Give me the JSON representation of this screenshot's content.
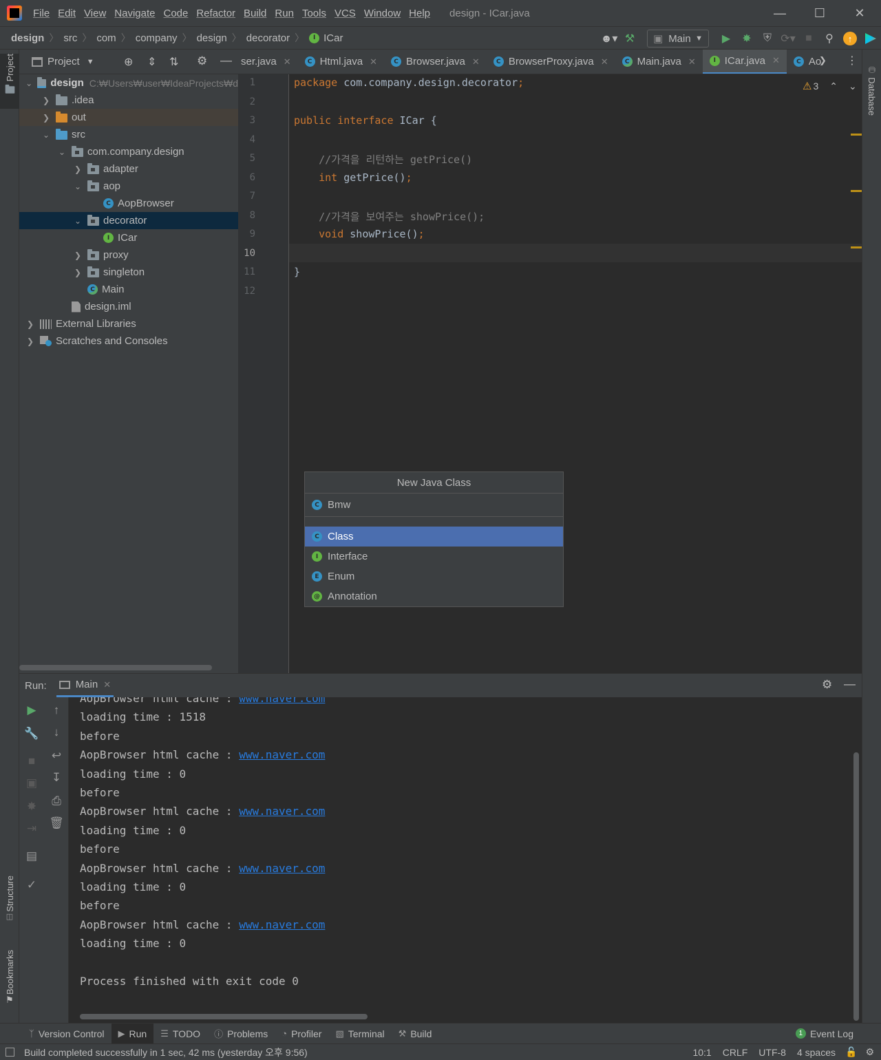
{
  "window": {
    "title": "design - ICar.java",
    "menu": [
      "File",
      "Edit",
      "View",
      "Navigate",
      "Code",
      "Refactor",
      "Build",
      "Run",
      "Tools",
      "VCS",
      "Window",
      "Help"
    ]
  },
  "breadcrumbs": [
    "design",
    "src",
    "com",
    "company",
    "design",
    "decorator",
    "ICar"
  ],
  "toolbar": {
    "run_config": "Main"
  },
  "project_panel": {
    "title": "Project",
    "root_path": "C:₩Users₩user₩IdeaProjects₩d",
    "tree": [
      {
        "label": "design",
        "level": 0,
        "expand": "open",
        "icon": "module-folder"
      },
      {
        "label": ".idea",
        "level": 1,
        "expand": "closed",
        "icon": "folder"
      },
      {
        "label": "out",
        "level": 1,
        "expand": "closed",
        "icon": "folder-orange"
      },
      {
        "label": "src",
        "level": 1,
        "expand": "open",
        "icon": "folder-blue"
      },
      {
        "label": "com.company.design",
        "level": 2,
        "expand": "open",
        "icon": "package"
      },
      {
        "label": "adapter",
        "level": 3,
        "expand": "closed",
        "icon": "package"
      },
      {
        "label": "aop",
        "level": 3,
        "expand": "open",
        "icon": "package"
      },
      {
        "label": "AopBrowser",
        "level": 4,
        "expand": "none",
        "icon": "class"
      },
      {
        "label": "decorator",
        "level": 3,
        "expand": "open",
        "icon": "package"
      },
      {
        "label": "ICar",
        "level": 4,
        "expand": "none",
        "icon": "interface"
      },
      {
        "label": "proxy",
        "level": 3,
        "expand": "closed",
        "icon": "package"
      },
      {
        "label": "singleton",
        "level": 3,
        "expand": "closed",
        "icon": "package"
      },
      {
        "label": "Main",
        "level": 3,
        "expand": "none",
        "icon": "class-run"
      },
      {
        "label": "design.iml",
        "level": 2,
        "expand": "none",
        "icon": "file"
      },
      {
        "label": "External Libraries",
        "level": 0,
        "expand": "closed",
        "icon": "libraries"
      },
      {
        "label": "Scratches and Consoles",
        "level": 0,
        "expand": "closed",
        "icon": "scratches"
      }
    ]
  },
  "editor_tabs": [
    {
      "label": "ser.java",
      "icon": "none",
      "active": false
    },
    {
      "label": "Html.java",
      "icon": "class",
      "active": false
    },
    {
      "label": "Browser.java",
      "icon": "class",
      "active": false
    },
    {
      "label": "BrowserProxy.java",
      "icon": "class",
      "active": false
    },
    {
      "label": "Main.java",
      "icon": "class-run",
      "active": false
    },
    {
      "label": "ICar.java",
      "icon": "interface",
      "active": true
    },
    {
      "label": "Ao",
      "icon": "class",
      "active": false
    }
  ],
  "editor": {
    "warnings": "3",
    "current_line": "10",
    "line_numbers": [
      "1",
      "2",
      "3",
      "4",
      "5",
      "6",
      "7",
      "8",
      "9",
      "10",
      "11",
      "12"
    ],
    "lines": [
      [
        {
          "t": "package ",
          "c": "kw"
        },
        {
          "t": "com.company.design.decorator",
          "c": "fn"
        },
        {
          "t": ";",
          "c": "kw"
        }
      ],
      [],
      [
        {
          "t": "public interface ",
          "c": "kw"
        },
        {
          "t": "ICar ",
          "c": "fn"
        },
        {
          "t": "{",
          "c": "fn"
        }
      ],
      [],
      [
        {
          "t": "    //가격을 리턴하는 getPrice()",
          "c": "cm"
        }
      ],
      [
        {
          "t": "    int ",
          "c": "kw"
        },
        {
          "t": "getPrice()",
          "c": "fn"
        },
        {
          "t": ";",
          "c": "kw"
        }
      ],
      [],
      [
        {
          "t": "    //가격을 보여주는 showPrice();",
          "c": "cm"
        }
      ],
      [
        {
          "t": "    void ",
          "c": "kw"
        },
        {
          "t": "showPrice()",
          "c": "fn"
        },
        {
          "t": ";",
          "c": "kw"
        }
      ],
      [],
      [
        {
          "t": "}",
          "c": "fn"
        }
      ],
      []
    ]
  },
  "popup": {
    "title": "New Java Class",
    "name_value": "Bmw",
    "options": [
      {
        "label": "Class",
        "icon": "class",
        "selected": true
      },
      {
        "label": "Interface",
        "icon": "interface",
        "selected": false
      },
      {
        "label": "Enum",
        "icon": "enum",
        "selected": false
      },
      {
        "label": "Annotation",
        "icon": "annotation",
        "selected": false
      }
    ]
  },
  "run_panel": {
    "label": "Run:",
    "tab": "Main",
    "output": [
      {
        "text": "AopBrowser html cache : ",
        "link": "www.naver.com"
      },
      {
        "text": "loading time : 1518"
      },
      {
        "text": "before"
      },
      {
        "text": "AopBrowser html cache : ",
        "link": "www.naver.com"
      },
      {
        "text": "loading time : 0"
      },
      {
        "text": "before"
      },
      {
        "text": "AopBrowser html cache : ",
        "link": "www.naver.com"
      },
      {
        "text": "loading time : 0"
      },
      {
        "text": "before"
      },
      {
        "text": "AopBrowser html cache : ",
        "link": "www.naver.com"
      },
      {
        "text": "loading time : 0"
      },
      {
        "text": "before"
      },
      {
        "text": "AopBrowser html cache : ",
        "link": "www.naver.com"
      },
      {
        "text": "loading time : 0"
      },
      {
        "text": ""
      },
      {
        "text": "Process finished with exit code 0"
      }
    ]
  },
  "side_tabs": {
    "left_top": "Project",
    "left_mid": "Structure",
    "left_bottom": "Bookmarks",
    "right": "Database"
  },
  "bottom_tabs": [
    {
      "label": "Version Control",
      "icon": "branch-icon",
      "active": false
    },
    {
      "label": "Run",
      "icon": "play-icon",
      "active": true
    },
    {
      "label": "TODO",
      "icon": "list-icon",
      "active": false
    },
    {
      "label": "Problems",
      "icon": "info-icon",
      "active": false
    },
    {
      "label": "Profiler",
      "icon": "profiler-icon",
      "active": false
    },
    {
      "label": "Terminal",
      "icon": "terminal-icon",
      "active": false
    },
    {
      "label": "Build",
      "icon": "hammer-icon",
      "active": false
    }
  ],
  "event_log": {
    "count": "1",
    "label": "Event Log"
  },
  "status": {
    "message": "Build completed successfully in 1 sec, 42 ms (yesterday 오후 9:56)",
    "position": "10:1",
    "line_sep": "CRLF",
    "encoding": "UTF-8",
    "indent": "4 spaces"
  }
}
